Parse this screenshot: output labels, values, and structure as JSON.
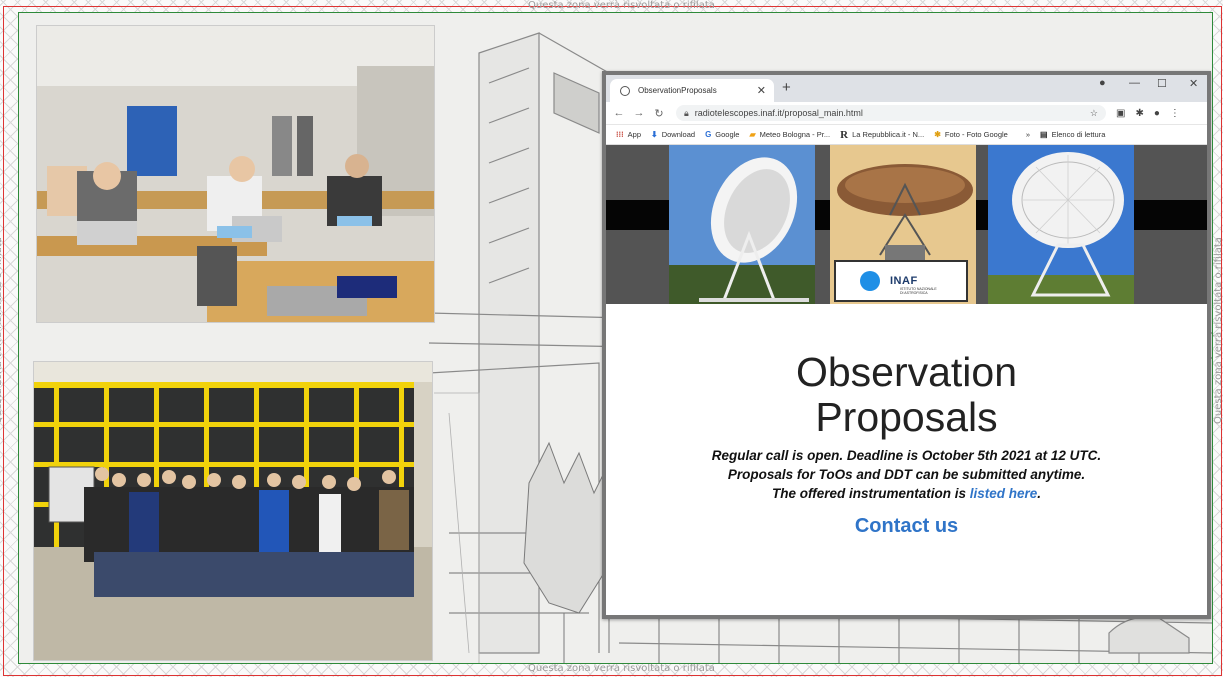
{
  "bleed": {
    "note": "Questa zona verrà risvoltata o rifilata"
  },
  "browser": {
    "tab_title": "ObservationProposals",
    "url": "radiotelescopes.inaf.it/proposal_main.html",
    "bookmarks": [
      {
        "icon": "apps-grid-icon",
        "label": "App"
      },
      {
        "icon": "download-icon",
        "label": "Download"
      },
      {
        "icon": "google-icon",
        "label": "Google"
      },
      {
        "icon": "weather-icon",
        "label": "Meteo Bologna - Pr..."
      },
      {
        "icon": "repubblica-icon",
        "label": "La Repubblica.it - N..."
      },
      {
        "icon": "photos-icon",
        "label": "Foto - Foto Google"
      }
    ],
    "bookmarks_overflow": "»",
    "reading_list": "Elenco di lettura",
    "page": {
      "title_line1": "Observation",
      "title_line2": "Proposals",
      "line1": "Regular call is open. Deadline is October 5th 2021 at 12 UTC.",
      "line2": "Proposals for ToOs and DDT can be submitted anytime.",
      "line3_prefix": "The offered instrumentation is ",
      "line3_link": "listed here",
      "line3_suffix": ".",
      "contact": "Contact us",
      "logo_text": "INAF",
      "logo_sub": "ISTITUTO NAZIONALE DI ASTROFISICA"
    }
  },
  "colors": {
    "trim_line": "#2e8a3a",
    "bleed_line": "#dd3333",
    "link_blue": "#2f74c8",
    "inaf_blue": "#1f8fe6"
  }
}
